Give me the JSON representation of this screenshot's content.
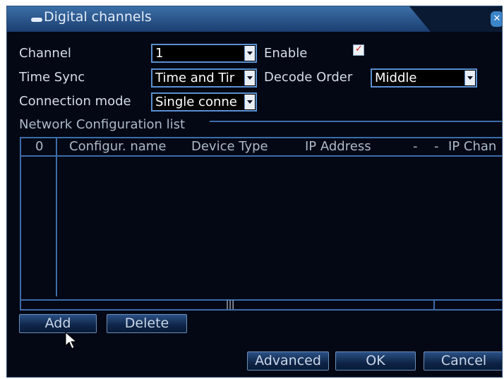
{
  "window": {
    "title": "Digital channels"
  },
  "form": {
    "channel_label": "Channel",
    "channel_value": "1",
    "enable_label": "Enable",
    "enable_checked": true,
    "timesync_label": "Time Sync",
    "timesync_value": "Time and Tir",
    "decode_label": "Decode Order",
    "decode_value": "Middle",
    "connmode_label": "Connection mode",
    "connmode_value": "Single conne"
  },
  "network": {
    "section_label": "Network Configuration list",
    "columns": [
      "0",
      "Configur. name",
      "Device Type",
      "IP Address",
      "-",
      "-",
      "IP Chan"
    ],
    "rows": []
  },
  "buttons": {
    "add": "Add",
    "delete": "Delete",
    "advanced": "Advanced",
    "ok": "OK",
    "cancel": "Cancel"
  },
  "colors": {
    "accent": "#3d6ca8",
    "background": "#030814",
    "title_bar": "#1b3e70",
    "checkmark": "#d62020"
  }
}
